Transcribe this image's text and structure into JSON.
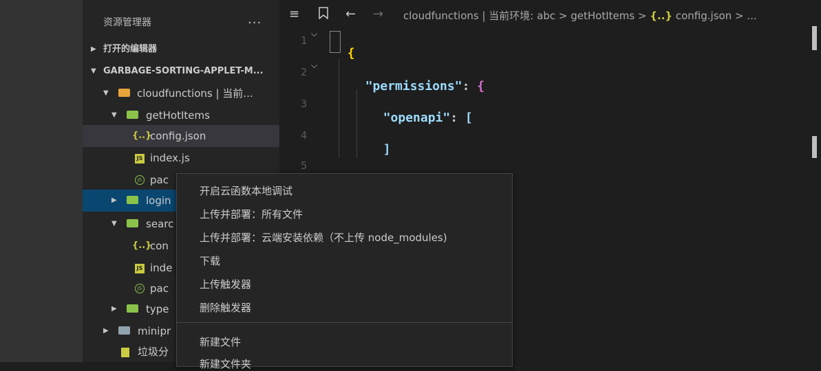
{
  "explorer": {
    "title": "资源管理器",
    "more": "...",
    "open_editors": "打开的编辑器",
    "project": "GARBAGE-SORTING-APPLET-M...",
    "tree": [
      {
        "label": "cloudfunctions | 当前...",
        "icon": "folder-cloud-icon"
      },
      {
        "label": "getHotItems",
        "icon": "folder-icon"
      },
      {
        "label": "config.json",
        "icon": "json-file-icon"
      },
      {
        "label": "index.js",
        "icon": "js-file-icon"
      },
      {
        "label": "pac",
        "icon": "package-json-icon"
      },
      {
        "label": "login",
        "icon": "folder-icon"
      },
      {
        "label": "searc",
        "icon": "folder-icon"
      },
      {
        "label": "con",
        "icon": "json-file-icon"
      },
      {
        "label": "inde",
        "icon": "js-file-icon"
      },
      {
        "label": "pac",
        "icon": "package-json-icon"
      },
      {
        "label": "type",
        "icon": "folder-icon"
      },
      {
        "label": "minipr",
        "icon": "folder-icon"
      },
      {
        "label": "垃圾分",
        "icon": "file-icon"
      }
    ]
  },
  "toolbar": {
    "list_icon": "≡",
    "bookmark_icon": "bookmark",
    "back_icon": "←",
    "forward_icon": "→"
  },
  "breadcrumb": {
    "part1": "cloudfunctions | 当前环境: abc",
    "sep": ">",
    "part2": "getHotItems",
    "json_icon": "{..}",
    "part3": "config.json",
    "tail": "> ..."
  },
  "editor": {
    "line_numbers": [
      "1",
      "2",
      "3",
      "4",
      "5"
    ],
    "lines": {
      "l1_brace": "{",
      "l2_key": "\"permissions\"",
      "l2_colon": ": ",
      "l2_brace": "{",
      "l3_key": "\"openapi\"",
      "l3_colon": ": ",
      "l3_bracket": "[",
      "l4_bracket": "]",
      "l5_brace": "}"
    }
  },
  "context_menu": {
    "items": [
      "开启云函数本地调试",
      "上传并部署：所有文件",
      "上传并部署：云端安装依赖（不上传 node_modules)",
      "下载",
      "上传触发器",
      "删除触发器",
      "新建文件",
      "新建文件夹"
    ]
  },
  "colors": {
    "background": "#1e1e1e",
    "sidebar": "#252526",
    "selection": "#094771",
    "json_key": "#9cdcfe",
    "brace": "#ffd700",
    "bracket": "#da70d6"
  }
}
